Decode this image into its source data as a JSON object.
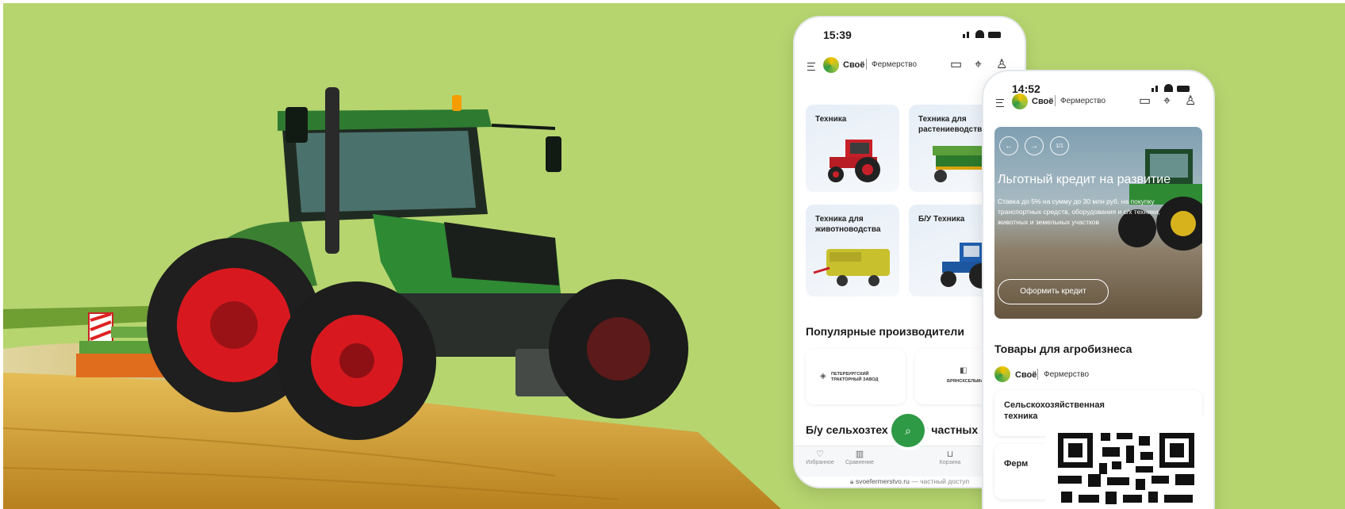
{
  "colors": {
    "background": "#b6d56f",
    "accent": "#2e9a45",
    "tractor_green": "#2f7d32",
    "wheel_red": "#d7191f",
    "field": "#d8a73a"
  },
  "phone1": {
    "time": "15:39",
    "brand": "Своё",
    "brand_sub": "Фермерство",
    "icons": [
      "menu-icon",
      "chat-icon",
      "location-icon",
      "profile-icon"
    ],
    "categories": [
      {
        "title": "Техника"
      },
      {
        "title": "Техника для растениеводства"
      },
      {
        "title": "Техника для животноводства"
      },
      {
        "title": "Б/У Техника"
      }
    ],
    "popular_title": "Популярные производители",
    "manufacturers": [
      {
        "name": "ПЕТЕРБУРГСКИЙ ТРАКТОРНЫЙ ЗАВОД"
      },
      {
        "name": "БРЯНСКСЕЛЬМАШ"
      }
    ],
    "used_title": "Б/у сельхозтехника от частных",
    "tabs": [
      {
        "label": "Избранное",
        "icon": "heart-icon"
      },
      {
        "label": "Сравнение",
        "icon": "compare-icon"
      },
      {
        "label": "Корзина",
        "icon": "cart-icon"
      }
    ],
    "url_domain": "svoefermerstvo.ru",
    "url_suffix": " — частный доступ"
  },
  "phone2": {
    "time": "14:52",
    "brand": "Своё",
    "brand_sub": "Фермерство",
    "hero": {
      "counter": "1/1",
      "title": "Льготный кредит на развитие",
      "text": "Ставка до 5% на сумму до 30 млн руб. на покупку транспортных средств, оборудования и с/х техники, животных и земельных участков",
      "button": "Оформить кредит"
    },
    "goods_title": "Товары для агробизнеса",
    "goods_cards": [
      {
        "title": "Сельскохозяйственная техника"
      },
      {
        "title": "Ферм"
      }
    ]
  }
}
